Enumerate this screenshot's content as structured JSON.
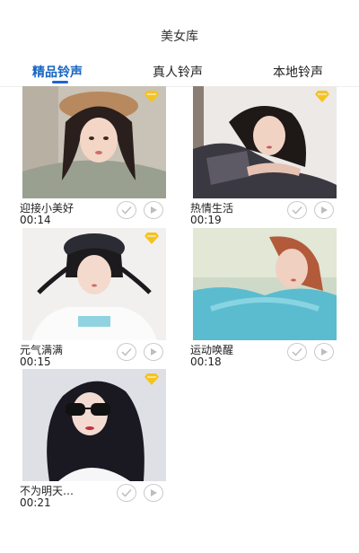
{
  "header": {
    "title": "美女库"
  },
  "tabs": [
    {
      "label": "精品铃声",
      "active": true
    },
    {
      "label": "真人铃声",
      "active": false
    },
    {
      "label": "本地铃声",
      "active": false
    }
  ],
  "colors": {
    "accent": "#1565c0",
    "vip_badge": "#f5c320"
  },
  "ringtones": [
    {
      "name": "迎接小美好",
      "duration": "00:14",
      "vip": true
    },
    {
      "name": "热情生活",
      "duration": "00:19",
      "vip": true
    },
    {
      "name": "元气满满",
      "duration": "00:15",
      "vip": true
    },
    {
      "name": "运动唤醒",
      "duration": "00:18",
      "vip": false
    },
    {
      "name": "不为明天…",
      "duration": "00:21",
      "vip": true
    }
  ],
  "icons": {
    "vip": "diamond-icon",
    "set": "check-icon",
    "play": "play-icon"
  }
}
